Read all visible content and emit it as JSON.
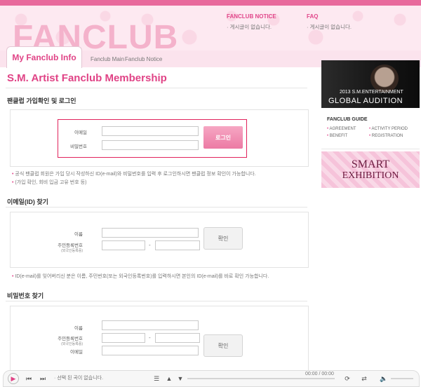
{
  "header": {
    "brand": "FANCLUB",
    "notice_title": "FANCLUB NOTICE",
    "notice_text": "· 게시글이 없습니다.",
    "faq_title": "FAQ",
    "faq_text": "· 게시글이 없습니다."
  },
  "tabs": {
    "active": "My Fanclub Info",
    "main": "Fanclub Main",
    "notice": "Fanclub Notice"
  },
  "page_title": "S.M. Artist Fanclub Membership",
  "login": {
    "heading": "팬클럽 가입확인 및 로그인",
    "email_label": "이메일",
    "password_label": "비밀번호",
    "button": "로그인",
    "note1": "공식 팬클럽 회원은 가입 당시 작성하신 ID(e-mail)와 비밀번호를 입력 후 로그인하시면 팬클럽 정보 확인이 가능합니다.",
    "note2": "(가입 확인, 회비 입금 고유 번호 등)"
  },
  "find_id": {
    "heading": "이메일(ID) 찾기",
    "name_label": "이름",
    "rrn_label": "주민등록번호",
    "rrn_sub": "(외국인등록증)",
    "dash": "-",
    "button": "확인",
    "note": "ID(e-mail)를 잊어버리신 분은 이름, 주민번호(또는 외국인등록번호)를 입력하시면 본인의 ID(e-mail)를 바로 확인 가능합니다."
  },
  "find_pw": {
    "heading": "비밀번호 찾기",
    "name_label": "이름",
    "rrn_label": "주민등록번호",
    "rrn_sub": "(외국인등록증)",
    "dash": "-",
    "email_label": "이메일",
    "button": "확인"
  },
  "sidebar": {
    "audition_line1": "2013 S.M.ENTERTAINMENT",
    "audition_line2": "GLOBAL AUDITION",
    "guide_title": "FANCLUB GUIDE",
    "guide_items": [
      "AGREEMENT",
      "ACTIVITY PERIOD",
      "BENEFIT",
      "REGISTRATION"
    ],
    "smart_line1": "SMART",
    "smart_line2": "EXHIBITION"
  },
  "player": {
    "status": "· 선택 된 곡이 없습니다.",
    "time": "00:00 / 00:00"
  },
  "colors": {
    "accent": "#e04386",
    "header_bg": "#fde9f1",
    "login_border": "#e1235c"
  }
}
